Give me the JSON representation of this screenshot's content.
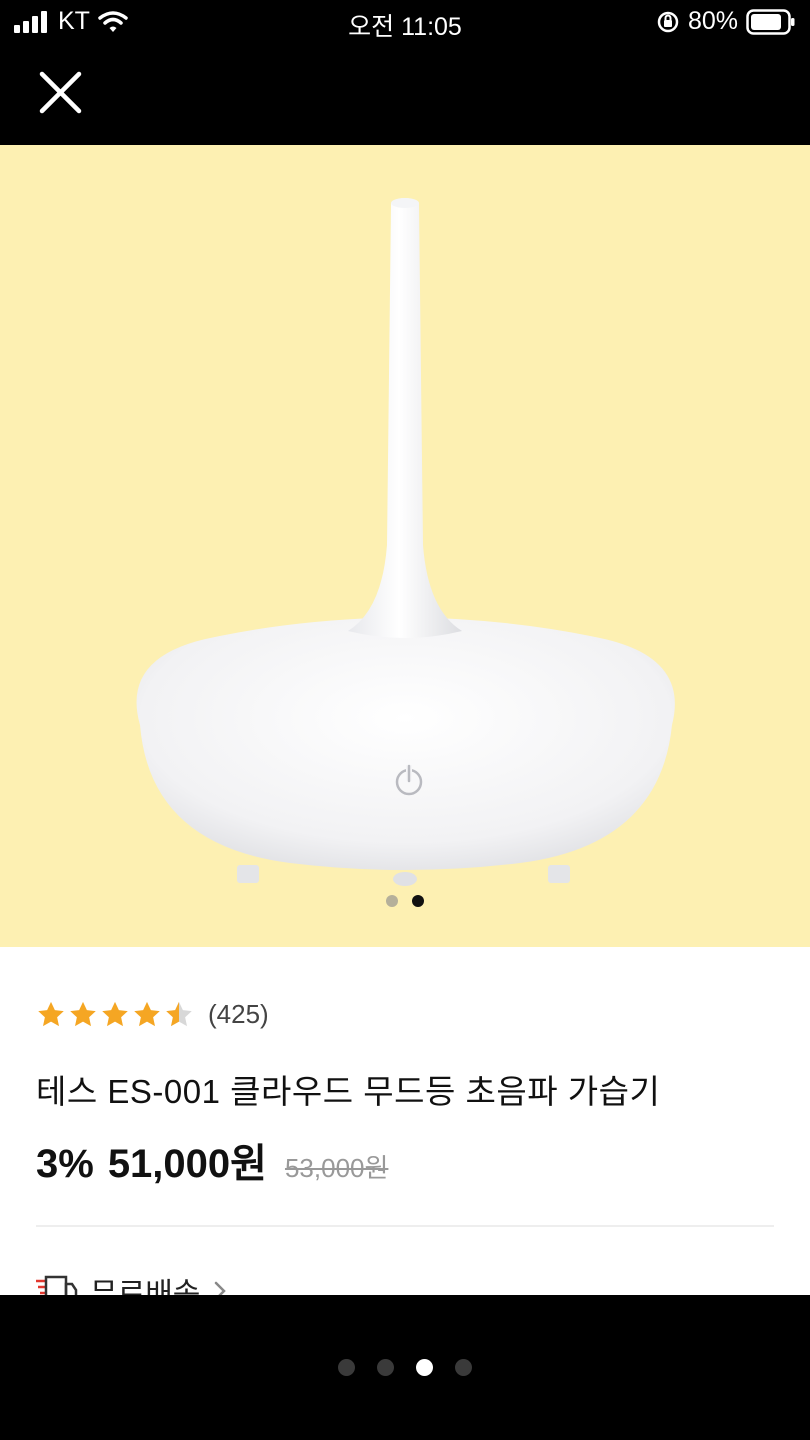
{
  "status_bar": {
    "carrier": "KT",
    "time": "오전 11:05",
    "battery": "80%"
  },
  "product": {
    "rating": 4.5,
    "review_count": "(425)",
    "title": "테스 ES-001 클라우드 무드등 초음파 가습기",
    "discount": "3%",
    "price": "51,000원",
    "original_price": "53,000원",
    "shipping": "무료배송"
  },
  "image_carousel": {
    "count": 2,
    "active_index": 1
  },
  "viewer_pager": {
    "count": 4,
    "active_index": 2
  },
  "colors": {
    "image_bg": "#fdf0b2",
    "star": "#f5a623",
    "page_bg": "#000000"
  }
}
